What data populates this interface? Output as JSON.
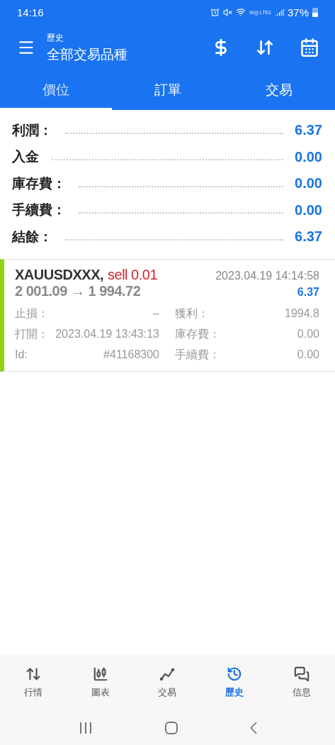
{
  "status_bar": {
    "time": "14:16",
    "network": "Vo)) LTE1",
    "battery": "37%"
  },
  "header": {
    "subtitle": "歷史",
    "title": "全部交易品種"
  },
  "tabs": [
    {
      "label": "價位",
      "selected": true
    },
    {
      "label": "訂單",
      "selected": false
    },
    {
      "label": "交易",
      "selected": false
    }
  ],
  "summary": [
    {
      "label": "利潤：",
      "value": "6.37"
    },
    {
      "label": "入金",
      "value": "0.00"
    },
    {
      "label": "庫存費：",
      "value": "0.00"
    },
    {
      "label": "手續費：",
      "value": "0.00"
    },
    {
      "label": "結餘：",
      "value": "6.37"
    }
  ],
  "deals": [
    {
      "symbol": "XAUUSDXXX,",
      "side": "sell 0.01",
      "prices": "2 001.09 → 1 994.72",
      "time": "2023.04.19 14:14:58",
      "profit": "6.37",
      "color": "#8fd313",
      "fields": [
        {
          "label": "止損：",
          "value": "–"
        },
        {
          "label": "獲利：",
          "value": "1994.8"
        },
        {
          "label": "打開：",
          "value": "2023.04.19 13:43:13"
        },
        {
          "label": "庫存費：",
          "value": "0.00"
        },
        {
          "label": "Id:",
          "value": "#41168300"
        },
        {
          "label": "手續費：",
          "value": "0.00"
        }
      ]
    }
  ],
  "bottom_nav": [
    {
      "kind": "quotes",
      "label": "行情",
      "selected": false
    },
    {
      "kind": "chart",
      "label": "圖表",
      "selected": false
    },
    {
      "kind": "trade",
      "label": "交易",
      "selected": false
    },
    {
      "kind": "history",
      "label": "歷史",
      "selected": true
    },
    {
      "kind": "messages",
      "label": "信息",
      "selected": false
    }
  ]
}
